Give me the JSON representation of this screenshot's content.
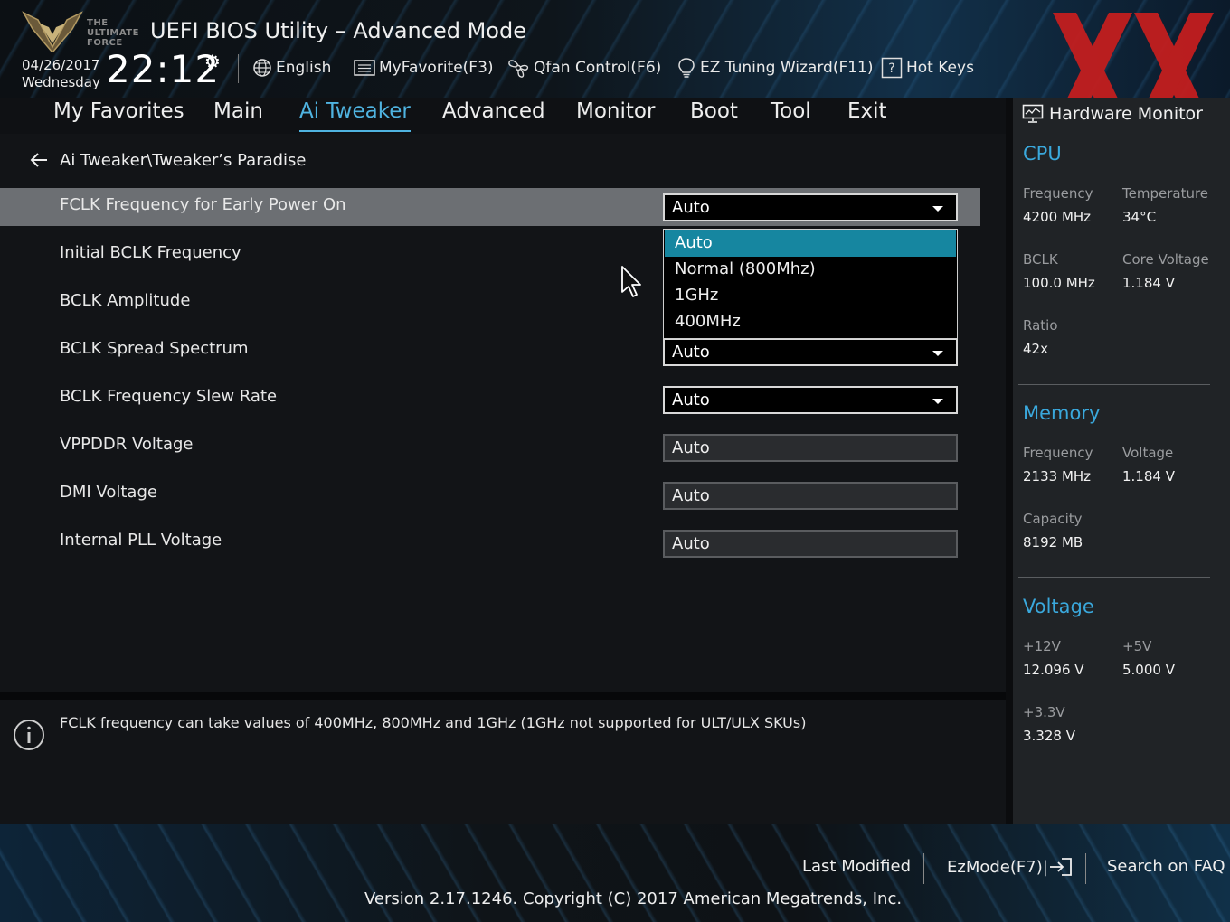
{
  "header": {
    "logo_text": "THE\nULTIMATE\nFORCE",
    "title": "UEFI BIOS Utility – Advanced Mode",
    "date": "04/26/2017",
    "weekday": "Wednesday",
    "time": "22:12",
    "toolbar": {
      "language": "English",
      "favorite": "MyFavorite(F3)",
      "qfan": "Qfan Control(F6)",
      "ez_tuning": "EZ Tuning Wizard(F11)",
      "hot_keys": "Hot Keys"
    }
  },
  "nav": {
    "tabs": [
      "My Favorites",
      "Main",
      "Ai Tweaker",
      "Advanced",
      "Monitor",
      "Boot",
      "Tool",
      "Exit"
    ],
    "active": "Ai Tweaker"
  },
  "breadcrumb": "Ai Tweaker\\Tweaker’s Paradise",
  "settings": [
    {
      "label": "FCLK Frequency for Early Power On",
      "value": "Auto"
    },
    {
      "label": "Initial BCLK Frequency",
      "value": ""
    },
    {
      "label": "BCLK Amplitude",
      "value": ""
    },
    {
      "label": "BCLK Spread Spectrum",
      "value": "Auto"
    },
    {
      "label": "BCLK Frequency Slew Rate",
      "value": "Auto"
    },
    {
      "label": "VPPDDR Voltage",
      "value": "Auto"
    },
    {
      "label": "DMI Voltage",
      "value": "Auto"
    },
    {
      "label": "Internal PLL Voltage",
      "value": "Auto"
    }
  ],
  "dropdown": {
    "options": [
      "Auto",
      "Normal (800Mhz)",
      "1GHz",
      "400MHz"
    ],
    "highlighted": "Auto"
  },
  "info_text": "FCLK frequency can take values of 400MHz, 800MHz  and 1GHz (1GHz not supported for ULT/ULX SKUs)",
  "hardware_monitor": {
    "title": "Hardware Monitor",
    "cpu": {
      "heading": "CPU",
      "frequency_label": "Frequency",
      "frequency": "4200 MHz",
      "temperature_label": "Temperature",
      "temperature": "34°C",
      "bclk_label": "BCLK",
      "bclk": "100.0 MHz",
      "core_voltage_label": "Core Voltage",
      "core_voltage": "1.184 V",
      "ratio_label": "Ratio",
      "ratio": "42x"
    },
    "memory": {
      "heading": "Memory",
      "frequency_label": "Frequency",
      "frequency": "2133 MHz",
      "voltage_label": "Voltage",
      "voltage": "1.184 V",
      "capacity_label": "Capacity",
      "capacity": "8192 MB"
    },
    "voltage": {
      "heading": "Voltage",
      "v12_label": "+12V",
      "v12": "12.096 V",
      "v5_label": "+5V",
      "v5": "5.000 V",
      "v33_label": "+3.3V",
      "v33": "3.328 V"
    }
  },
  "footer": {
    "last_modified": "Last Modified",
    "ezmode": "EzMode(F7)|",
    "search_faq": "Search on FAQ",
    "copyright": "Version 2.17.1246. Copyright (C) 2017 American Megatrends, Inc."
  },
  "colors": {
    "accent": "#3aa8dc",
    "highlight": "#1686a0",
    "selected_row": "#6c6f73",
    "watermark": "#c81e1e"
  }
}
